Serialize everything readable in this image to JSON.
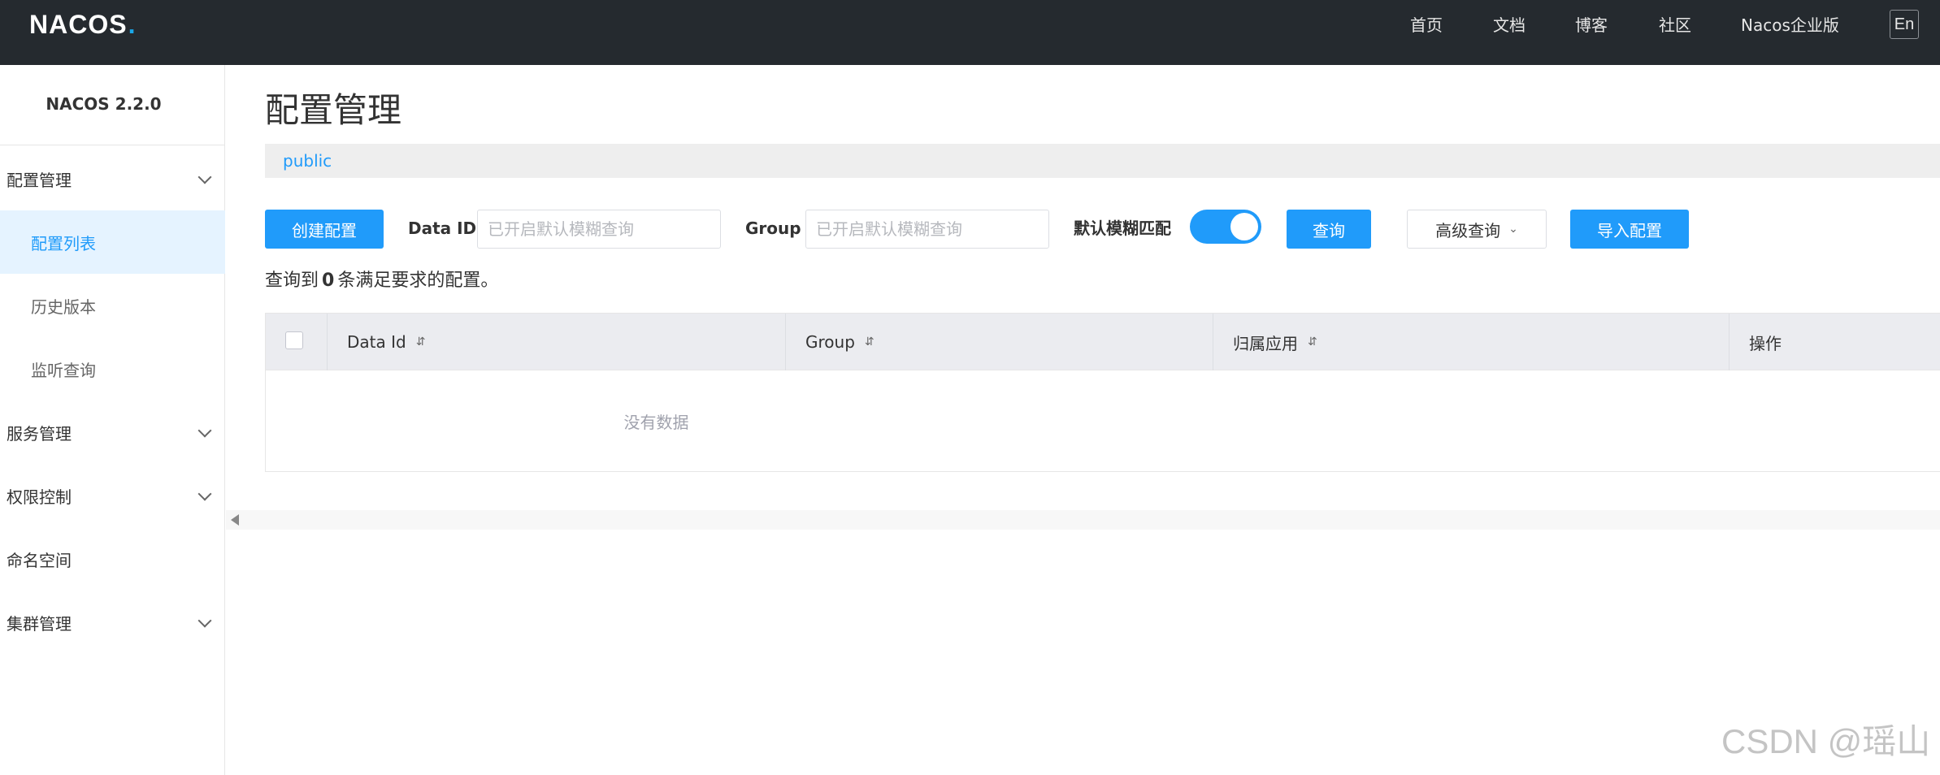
{
  "header": {
    "logo_text": "NACOS",
    "logo_dot": ".",
    "nav": [
      "首页",
      "文档",
      "博客",
      "社区",
      "Nacos企业版"
    ],
    "lang_button": "En"
  },
  "sidebar": {
    "version_title": "NACOS 2.2.0",
    "items": [
      {
        "label": "配置管理",
        "expandable": true
      },
      {
        "label": "配置列表",
        "sub": true,
        "active": true
      },
      {
        "label": "历史版本",
        "sub": true
      },
      {
        "label": "监听查询",
        "sub": true
      },
      {
        "label": "服务管理",
        "expandable": true
      },
      {
        "label": "权限控制",
        "expandable": true
      },
      {
        "label": "命名空间"
      },
      {
        "label": "集群管理",
        "expandable": true
      }
    ]
  },
  "main": {
    "page_title": "配置管理",
    "namespace": "public",
    "toolbar": {
      "create_button": "创建配置",
      "dataid_label": "Data ID",
      "dataid_placeholder": "已开启默认模糊查询",
      "group_label": "Group",
      "group_placeholder": "已开启默认模糊查询",
      "fuzzy_label": "默认模糊匹配",
      "fuzzy_enabled": true,
      "query_button": "查询",
      "advanced_query_button": "高级查询",
      "import_button": "导入配置"
    },
    "result": {
      "prefix": "查询到",
      "count": "0",
      "suffix": "条满足要求的配置。"
    },
    "table": {
      "columns": [
        "Data Id",
        "Group",
        "归属应用",
        "操作"
      ],
      "sort_icon": "⇵",
      "empty_text": "没有数据"
    }
  },
  "watermark": "CSDN @瑶山",
  "colors": {
    "header_bg": "#252a2f",
    "primary": "#209bfa",
    "active_menu_bg": "#e5f3ff",
    "table_header_bg": "#ebecf0"
  }
}
